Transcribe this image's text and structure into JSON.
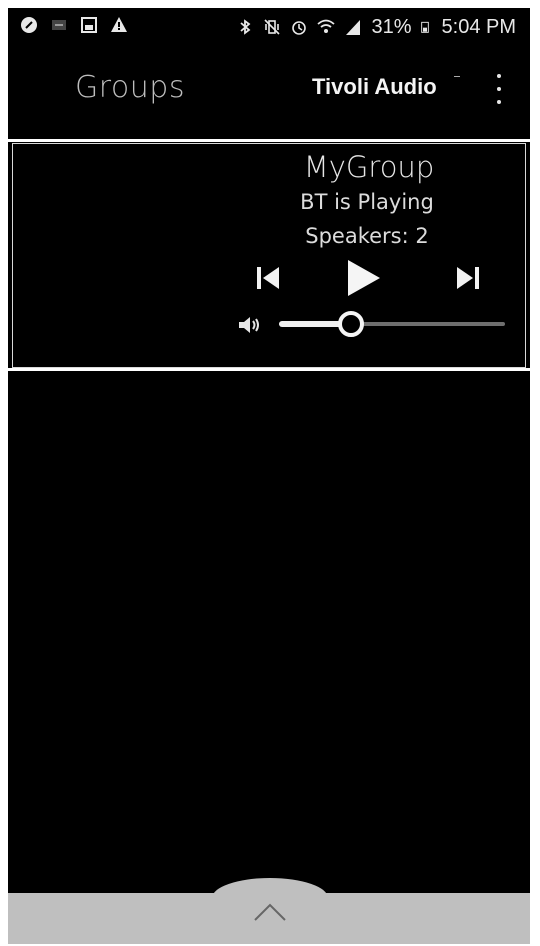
{
  "status_bar": {
    "battery_percent": "31%",
    "time": "5:04 PM",
    "icons": [
      "notification-icon",
      "image-icon",
      "warning-icon",
      "bluetooth-icon",
      "vibrate-icon",
      "alarm-icon",
      "wifi-icon",
      "signal-icon",
      "battery-icon"
    ]
  },
  "app_bar": {
    "title": "Groups",
    "brand": "Tivoli Audio"
  },
  "group": {
    "name": "MyGroup",
    "status": "BT is Playing",
    "speakers_label": "Speakers:",
    "speakers_count": "2",
    "volume_fraction": 0.32
  },
  "colors": {
    "background": "#000000",
    "text": "#e6e6e6",
    "title": "#bdbdbd",
    "bottom_bar": "#bfbfbf"
  }
}
